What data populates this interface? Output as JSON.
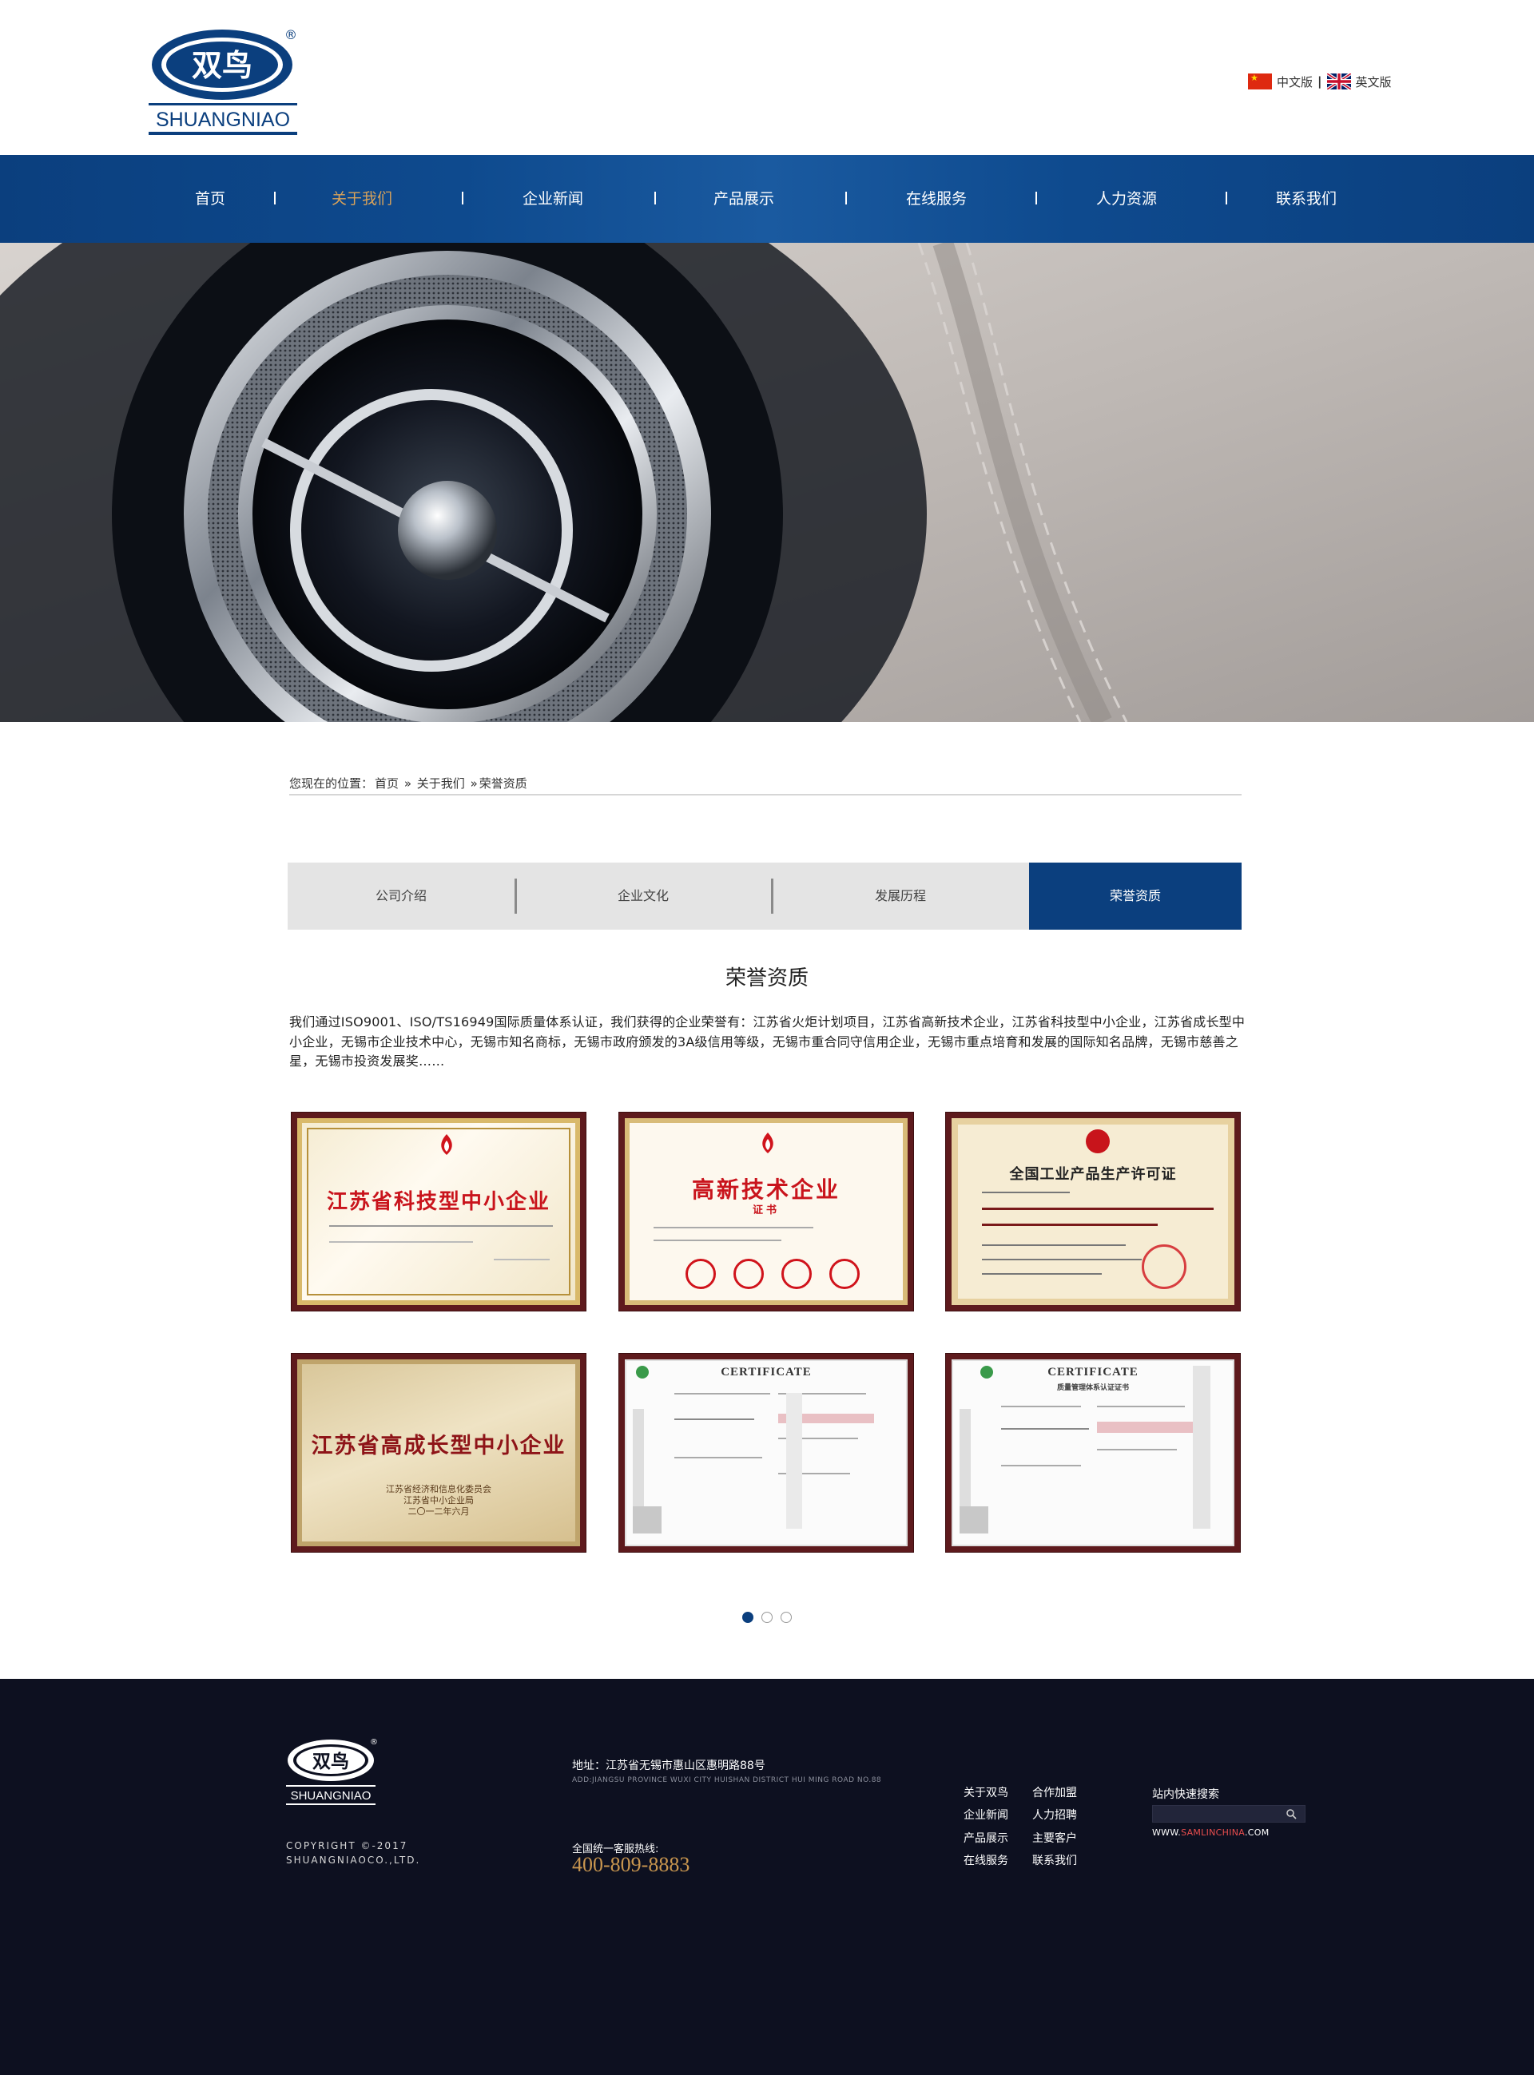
{
  "brand": {
    "logo_cn": "双鸟",
    "logo_en": "SHUANGNIAO",
    "registered": "®"
  },
  "lang": {
    "cn": "中文版",
    "sep": "|",
    "en": "英文版"
  },
  "nav": {
    "items": [
      {
        "label": "首页"
      },
      {
        "label": "关于我们"
      },
      {
        "label": "企业新闻"
      },
      {
        "label": "产品展示"
      },
      {
        "label": "在线服务"
      },
      {
        "label": "人力资源"
      },
      {
        "label": "联系我们"
      }
    ],
    "active_index": 1,
    "sep": "|"
  },
  "breadcrumb": {
    "prefix": "您现在的位置：",
    "home": "首页",
    "sep1": "»",
    "parent": "关于我们",
    "sep2": "»",
    "current": "荣誉资质"
  },
  "tabs": {
    "items": [
      {
        "label": "公司介绍"
      },
      {
        "label": "企业文化"
      },
      {
        "label": "发展历程"
      },
      {
        "label": "荣誉资质"
      }
    ],
    "active_index": 3
  },
  "section": {
    "title": "荣誉资质",
    "intro": "我们通过ISO9001、ISO/TS16949国际质量体系认证，我们获得的企业荣誉有：江苏省火炬计划项目，江苏省高新技术企业，江苏省科技型中小企业，江苏省成长型中小企业，无锡市企业技术中心，无锡市知名商标，无锡市政府颁发的3A级信用等级，无锡市重合同守信用企业，无锡市重点培育和发展的国际知名品牌，无锡市慈善之星，无锡市投资发展奖……"
  },
  "certificates": [
    {
      "title": "江苏省科技型中小企业"
    },
    {
      "title": "高新技术企业",
      "subtitle": "证书"
    },
    {
      "title": "全国工业产品生产许可证"
    },
    {
      "title": "江苏省高成长型中小企业",
      "footer": "江苏省经济和信息化委员会\n江苏省中小企业局\n二〇一二年六月"
    },
    {
      "title": "CERTIFICATE"
    },
    {
      "title": "CERTIFICATE",
      "subtitle": "质量管理体系认证证书"
    }
  ],
  "pager": {
    "count": 3,
    "active_index": 0
  },
  "footer": {
    "copyright_1": "COPYRIGHT ©-2017",
    "copyright_2": "SHUANGNIAOCO.,LTD.",
    "address": "地址：江苏省无锡市惠山区惠明路88号",
    "address_en": "ADD:JIANGSU PROVINCE WUXI CITY HUISHAN DISTRICT HUI MING ROAD NO.88",
    "hotline_label": "全国统一客服热线:",
    "hotline": "400-809-8883",
    "links": [
      {
        "label": "关于双鸟"
      },
      {
        "label": "合作加盟"
      },
      {
        "label": "企业新闻"
      },
      {
        "label": "人力招聘"
      },
      {
        "label": "产品展示"
      },
      {
        "label": "主要客户"
      },
      {
        "label": "在线服务"
      },
      {
        "label": "联系我们"
      }
    ],
    "search_label": "站内快速搜索",
    "search_value": "",
    "url_prefix": "WWW.",
    "url_mid": "SAMLINCHINA",
    "url_suffix": ".COM"
  },
  "colors": {
    "brand_blue": "#0b3f7e",
    "accent_gold": "#d8a25a",
    "footer_bg": "#0d1020",
    "cert_frame": "#5e1a1d"
  }
}
